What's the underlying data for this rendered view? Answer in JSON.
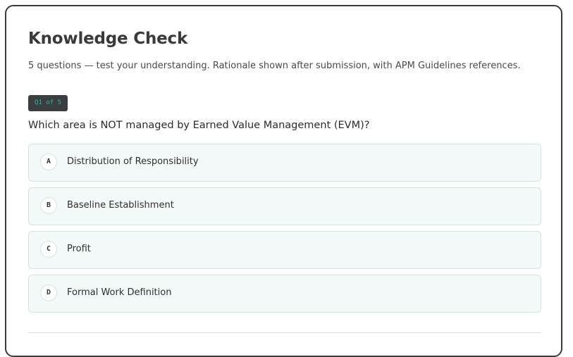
{
  "quiz": {
    "title": "Knowledge Check",
    "subtitle": "5 questions — test your understanding. Rationale shown after submission, with APM Guidelines references.",
    "progress_badge": "Q1 of 5",
    "question": "Which area is NOT managed by Earned Value Management (EVM)?",
    "options": [
      {
        "letter": "A",
        "text": "Distribution of Responsibility"
      },
      {
        "letter": "B",
        "text": "Baseline Establishment"
      },
      {
        "letter": "C",
        "text": "Profit"
      },
      {
        "letter": "D",
        "text": "Formal Work Definition"
      }
    ]
  },
  "colors": {
    "option_bg": "#f3f9f8",
    "option_border": "#cfe3e0",
    "badge_bg": "#3a3e40",
    "badge_text": "#2bb6a8"
  }
}
